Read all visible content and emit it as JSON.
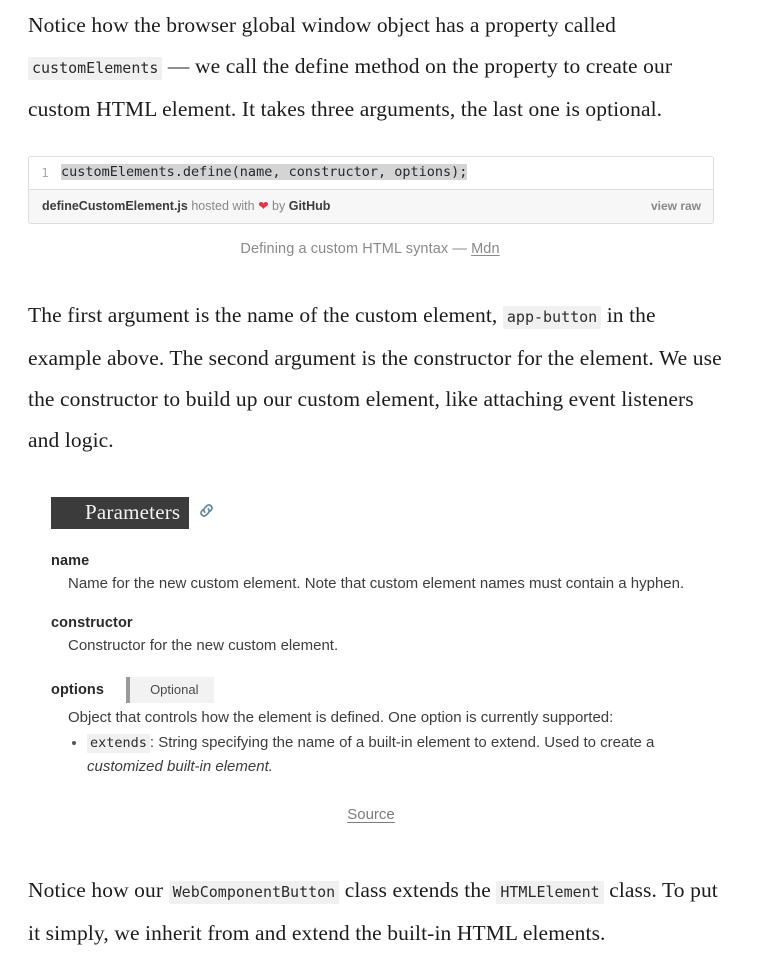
{
  "paragraph_1": {
    "part_1": "Notice how the browser global window object has a property called",
    "code": "customElements",
    "part_2": "— we call the define method on the property to create our custom HTML element. It takes three arguments, the last one is optional."
  },
  "gist": {
    "line_number": "1",
    "code": "customElements.define(name, constructor, options);",
    "filename": "defineCustomElement.js",
    "hosted_with": "hosted with",
    "heart": "❤",
    "by": "by",
    "provider": "GitHub",
    "view_raw": "view raw"
  },
  "caption": {
    "text": "Defining a custom HTML syntax —",
    "link": "Mdn"
  },
  "paragraph_2": {
    "part_1": "The first argument is the name of the custom element,",
    "code": "app-button",
    "part_2": "in the example above. The second argument is the constructor for the element. We use the constructor to build up our custom element, like attaching event listeners and logic."
  },
  "mdn": {
    "heading": "Parameters",
    "link_icon": "link-icon",
    "params": [
      {
        "name": "name",
        "description": "Name for the new custom element. Note that custom element names must contain a hyphen."
      },
      {
        "name": "constructor",
        "description": "Constructor for the new custom element."
      },
      {
        "name": "options",
        "badge": "Optional",
        "description": "Object that controls how the element is defined. One option is currently supported:",
        "list": [
          {
            "code": "extends",
            "text_1": ": String specifying the name of a built-in element to extend. Used to create a",
            "italic": "customized built-in element."
          }
        ]
      }
    ],
    "source_label": "Source"
  },
  "paragraph_3": {
    "part_1": "Notice how our",
    "code_1": "WebComponentButton",
    "part_2": "class extends the",
    "code_2": "HTMLElement",
    "part_3": "class. To put it simply, we inherit from and extend the built-in HTML elements."
  },
  "colors": {
    "heading_bg": "#3b3b3b",
    "code_bg": "#f0f0f0",
    "gist_footer_bg": "#f7f7f7",
    "gist_border": "#dddddd",
    "link_icon": "#5b7f9c",
    "heart": "#e8324a",
    "muted_text": "#8a8a8a"
  }
}
